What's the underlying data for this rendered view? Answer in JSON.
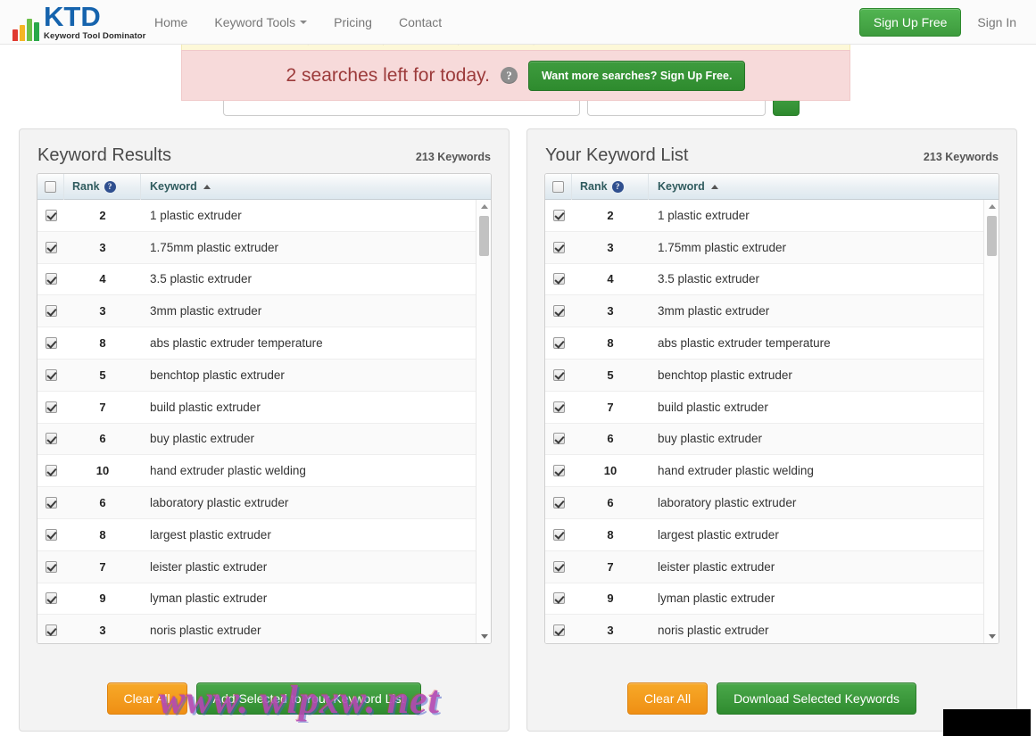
{
  "brand": {
    "logo_main": "KTD",
    "logo_tagline": "Keyword Tool Dominator",
    "logo_colors": [
      "#e03a30",
      "#f5b524",
      "#6cc04a",
      "#2aa84a"
    ],
    "logo_text_color": "#1563ad"
  },
  "nav": {
    "items": [
      {
        "label": "Home",
        "has_caret": false
      },
      {
        "label": "Keyword Tools",
        "has_caret": true
      },
      {
        "label": "Pricing",
        "has_caret": false
      },
      {
        "label": "Contact",
        "has_caret": false
      }
    ],
    "sign_up_label": "Sign Up Free",
    "sign_in_label": "Sign In",
    "sign_up_color": "#3d9b3d"
  },
  "banner": {
    "searches_left_text": "2 searches left for today.",
    "help_icon": "question-mark-icon",
    "cta_label": "Want more searches? Sign Up Free.",
    "background_color": "#f7dada",
    "text_color": "#9c3b3b",
    "cta_color": "#2e8b2e"
  },
  "strip": {
    "text": "· · · ·",
    "background_color": "#fdf8d8"
  },
  "search": {
    "keyword_value": "",
    "keyword_placeholder": "",
    "engine_value": "",
    "engine_placeholder": "",
    "button_label": ""
  },
  "left_panel": {
    "title": "Keyword Results",
    "count_label": "213 Keywords",
    "columns": {
      "select_all": "select-all-checkbox",
      "rank": "Rank",
      "rank_help": "?",
      "keyword": "Keyword",
      "sort_indicator": "ascending"
    },
    "header_select_all_checked": false,
    "rows": [
      {
        "checked": true,
        "rank": "2",
        "keyword": "1 plastic extruder"
      },
      {
        "checked": true,
        "rank": "3",
        "keyword": "1.75mm plastic extruder"
      },
      {
        "checked": true,
        "rank": "4",
        "keyword": "3.5 plastic extruder"
      },
      {
        "checked": true,
        "rank": "3",
        "keyword": "3mm plastic extruder"
      },
      {
        "checked": true,
        "rank": "8",
        "keyword": "abs plastic extruder temperature"
      },
      {
        "checked": true,
        "rank": "5",
        "keyword": "benchtop plastic extruder"
      },
      {
        "checked": true,
        "rank": "7",
        "keyword": "build plastic extruder"
      },
      {
        "checked": true,
        "rank": "6",
        "keyword": "buy plastic extruder"
      },
      {
        "checked": true,
        "rank": "10",
        "keyword": "hand extruder plastic welding"
      },
      {
        "checked": true,
        "rank": "6",
        "keyword": "laboratory plastic extruder"
      },
      {
        "checked": true,
        "rank": "8",
        "keyword": "largest plastic extruder"
      },
      {
        "checked": true,
        "rank": "7",
        "keyword": "leister plastic extruder"
      },
      {
        "checked": true,
        "rank": "9",
        "keyword": "lyman plastic extruder"
      },
      {
        "checked": true,
        "rank": "3",
        "keyword": "noris plastic extruder"
      }
    ],
    "clear_label": "Clear All",
    "action_label": "Add Selected to Your Keyword List"
  },
  "right_panel": {
    "title": "Your Keyword List",
    "count_label": "213 Keywords",
    "columns": {
      "select_all": "select-all-checkbox",
      "rank": "Rank",
      "rank_help": "?",
      "keyword": "Keyword",
      "sort_indicator": "ascending"
    },
    "header_select_all_checked": false,
    "rows": [
      {
        "checked": true,
        "rank": "2",
        "keyword": "1 plastic extruder"
      },
      {
        "checked": true,
        "rank": "3",
        "keyword": "1.75mm plastic extruder"
      },
      {
        "checked": true,
        "rank": "4",
        "keyword": "3.5 plastic extruder"
      },
      {
        "checked": true,
        "rank": "3",
        "keyword": "3mm plastic extruder"
      },
      {
        "checked": true,
        "rank": "8",
        "keyword": "abs plastic extruder temperature"
      },
      {
        "checked": true,
        "rank": "5",
        "keyword": "benchtop plastic extruder"
      },
      {
        "checked": true,
        "rank": "7",
        "keyword": "build plastic extruder"
      },
      {
        "checked": true,
        "rank": "6",
        "keyword": "buy plastic extruder"
      },
      {
        "checked": true,
        "rank": "10",
        "keyword": "hand extruder plastic welding"
      },
      {
        "checked": true,
        "rank": "6",
        "keyword": "laboratory plastic extruder"
      },
      {
        "checked": true,
        "rank": "8",
        "keyword": "largest plastic extruder"
      },
      {
        "checked": true,
        "rank": "7",
        "keyword": "leister plastic extruder"
      },
      {
        "checked": true,
        "rank": "9",
        "keyword": "lyman plastic extruder"
      },
      {
        "checked": true,
        "rank": "3",
        "keyword": "noris plastic extruder"
      }
    ],
    "clear_label": "Clear All",
    "action_label": "Download Selected Keywords"
  },
  "watermark": {
    "text": "www. wlpxw. net",
    "color": "#b24ab2"
  }
}
